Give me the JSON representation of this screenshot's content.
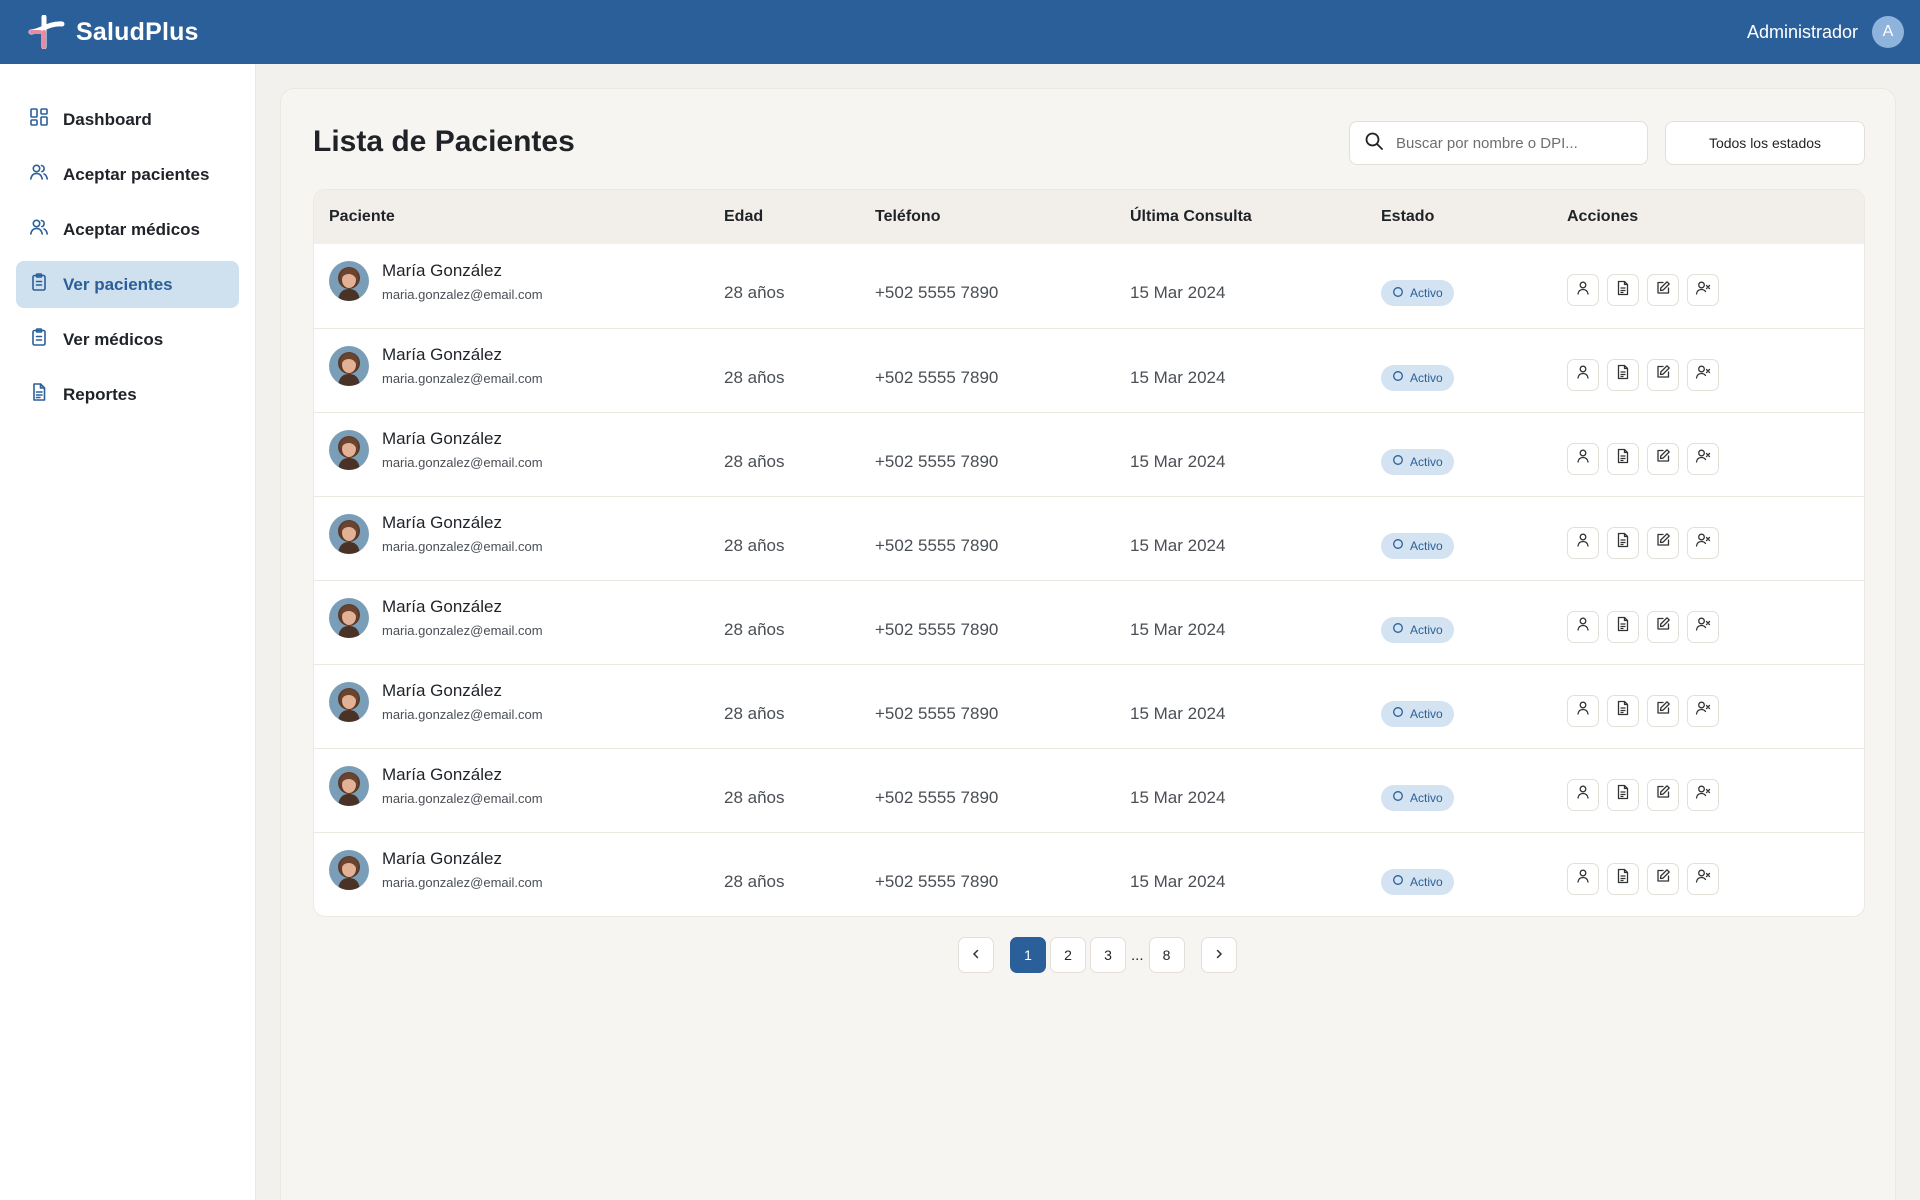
{
  "app": {
    "brand": "SaludPlus",
    "user_name": "Administrador",
    "user_initial": "A",
    "colors": {
      "primary": "#2b5f99",
      "active_bg": "#cfe0ef",
      "badge_bg": "#d3e3f1"
    }
  },
  "sidebar": {
    "items": [
      {
        "label": "Dashboard",
        "icon": "dashboard-grid-icon",
        "active": false
      },
      {
        "label": "Aceptar pacientes",
        "icon": "users-icon",
        "active": false
      },
      {
        "label": "Aceptar médicos",
        "icon": "users-icon",
        "active": false
      },
      {
        "label": "Ver pacientes",
        "icon": "clipboard-icon",
        "active": true
      },
      {
        "label": "Ver médicos",
        "icon": "clipboard-icon",
        "active": false
      },
      {
        "label": "Reportes",
        "icon": "document-icon",
        "active": false
      }
    ]
  },
  "main": {
    "title": "Lista de Pacientes",
    "search_placeholder": "Buscar por nombre o DPI...",
    "status_filter": "Todos los estados"
  },
  "table": {
    "headers": {
      "patient": "Paciente",
      "age": "Edad",
      "phone": "Teléfono",
      "last_visit": "Última Consulta",
      "status": "Estado",
      "actions": "Acciones"
    },
    "rows": [
      {
        "name": "María González",
        "email": "maria.gonzalez@email.com",
        "age": "28 años",
        "phone": "+502 5555 7890",
        "last_visit": "15 Mar 2024",
        "status": "Activo"
      },
      {
        "name": "María González",
        "email": "maria.gonzalez@email.com",
        "age": "28 años",
        "phone": "+502 5555 7890",
        "last_visit": "15 Mar 2024",
        "status": "Activo"
      },
      {
        "name": "María González",
        "email": "maria.gonzalez@email.com",
        "age": "28 años",
        "phone": "+502 5555 7890",
        "last_visit": "15 Mar 2024",
        "status": "Activo"
      },
      {
        "name": "María González",
        "email": "maria.gonzalez@email.com",
        "age": "28 años",
        "phone": "+502 5555 7890",
        "last_visit": "15 Mar 2024",
        "status": "Activo"
      },
      {
        "name": "María González",
        "email": "maria.gonzalez@email.com",
        "age": "28 años",
        "phone": "+502 5555 7890",
        "last_visit": "15 Mar 2024",
        "status": "Activo"
      },
      {
        "name": "María González",
        "email": "maria.gonzalez@email.com",
        "age": "28 años",
        "phone": "+502 5555 7890",
        "last_visit": "15 Mar 2024",
        "status": "Activo"
      },
      {
        "name": "María González",
        "email": "maria.gonzalez@email.com",
        "age": "28 años",
        "phone": "+502 5555 7890",
        "last_visit": "15 Mar 2024",
        "status": "Activo"
      },
      {
        "name": "María González",
        "email": "maria.gonzalez@email.com",
        "age": "28 años",
        "phone": "+502 5555 7890",
        "last_visit": "15 Mar 2024",
        "status": "Activo"
      }
    ],
    "action_icons": [
      "user-profile-icon",
      "document-icon",
      "edit-icon",
      "user-remove-icon"
    ]
  },
  "pagination": {
    "pages": [
      "1",
      "2",
      "3"
    ],
    "ellipsis": "...",
    "last_page": "8",
    "current": "1",
    "prev_icon": "chevron-left-icon",
    "next_icon": "chevron-right-icon"
  }
}
